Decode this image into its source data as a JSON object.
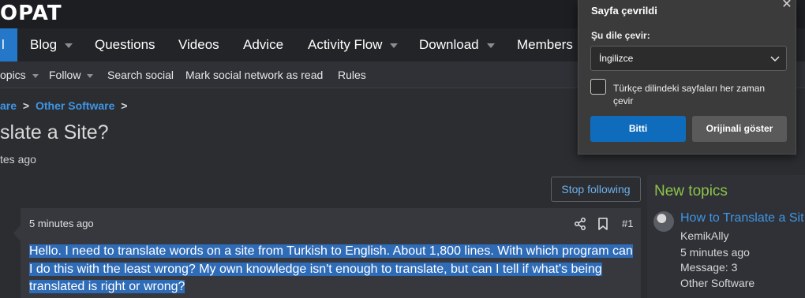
{
  "header": {
    "logo_text": "OPAT"
  },
  "nav": {
    "active_fragment": "l",
    "items": [
      {
        "label": "Blog",
        "has_caret": true
      },
      {
        "label": "Questions",
        "has_caret": false
      },
      {
        "label": "Videos",
        "has_caret": false
      },
      {
        "label": "Advice",
        "has_caret": false
      },
      {
        "label": "Activity Flow",
        "has_caret": true
      },
      {
        "label": "Download",
        "has_caret": true
      },
      {
        "label": "Members",
        "has_caret": false
      }
    ]
  },
  "subnav": {
    "items": [
      {
        "label": "opics",
        "has_caret": true
      },
      {
        "label": "Follow",
        "has_caret": true
      },
      {
        "label": "Search social",
        "has_caret": false
      },
      {
        "label": "Mark social network as read",
        "has_caret": false
      },
      {
        "label": "Rules",
        "has_caret": false
      }
    ]
  },
  "breadcrumb": {
    "prev": "are",
    "current": "Other Software",
    "separator": ">"
  },
  "thread": {
    "title": "slate a Site?",
    "meta": "tes ago",
    "stop_following_label": "Stop following"
  },
  "post": {
    "time": "5 minutes ago",
    "number": "#1",
    "body": "Hello. I need to translate words on a site from Turkish to English. About 1,800 lines. With which program can I do this with the least wrong? My own knowledge isn't enough to translate, but can I tell if what's being translated is right or wrong?"
  },
  "sidebar": {
    "title": "New topics",
    "topic": {
      "title": "How to Translate a Sit",
      "author": "KemikAlly",
      "time": "5 minutes ago",
      "messages": "Message: 3",
      "forum": "Other Software"
    }
  },
  "translate_popup": {
    "title": "Sayfa çevrildi",
    "language_label": "Şu dile çevir:",
    "language_value": "İngilizce",
    "always_translate_label": "Türkçe dilindeki sayfaları her zaman çevir",
    "done_label": "Bitti",
    "show_original_label": "Orijinali göster",
    "close_symbol": "✕"
  },
  "colors": {
    "accent": "#2577c9",
    "link": "#3e96e6",
    "sidebar_title": "#8dc34a",
    "selection": "#2f6cb8"
  }
}
